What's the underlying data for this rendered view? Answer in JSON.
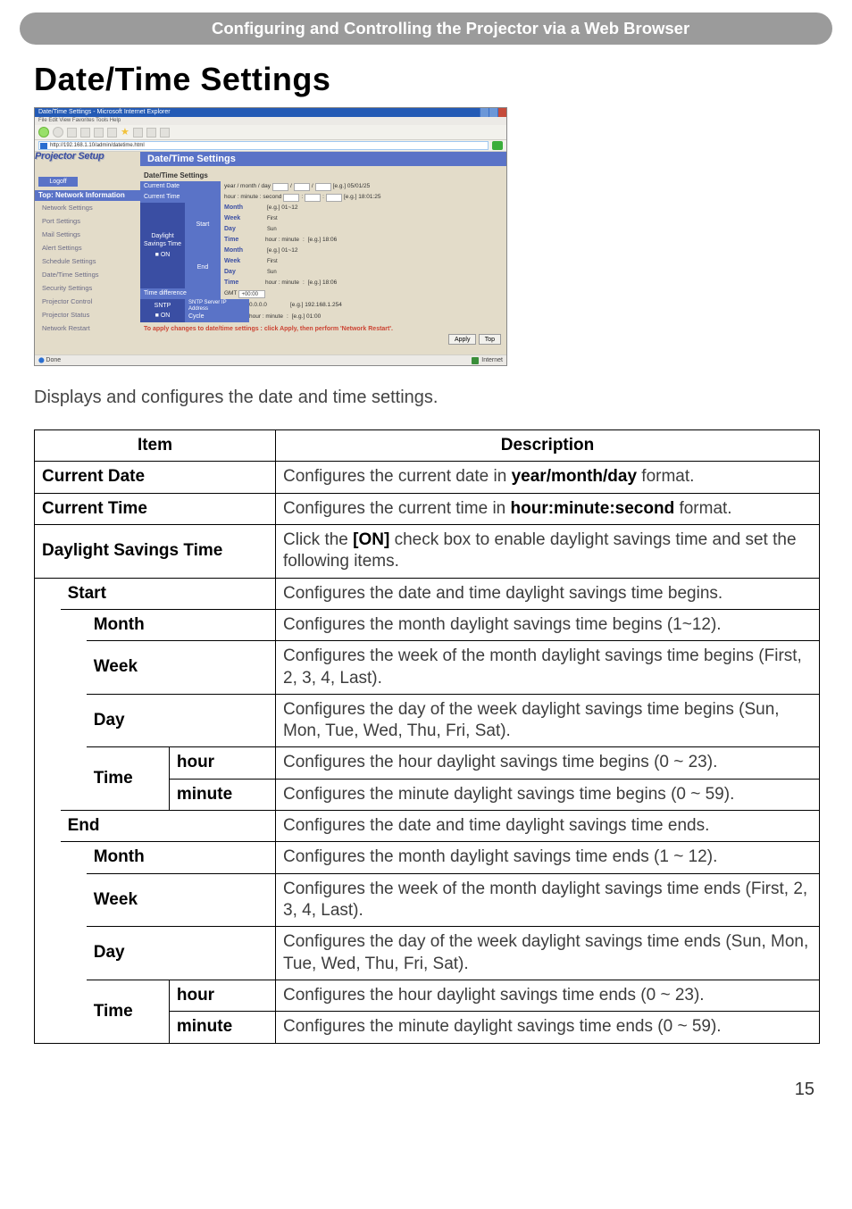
{
  "header_band": "Configuring and Controlling the Projector via a Web Browser",
  "page_title": "Date/Time Settings",
  "intro": "Displays and configures the date and time settings.",
  "page_number": "15",
  "table": {
    "head_item": "Item",
    "head_desc": "Description",
    "current_date": {
      "label": "Current Date",
      "desc_pre": "Configures the current date in ",
      "bold": "year/month/day",
      "desc_post": " format."
    },
    "current_time": {
      "label": "Current Time",
      "desc_pre": "Configures the current time in ",
      "bold": "hour:minute:second",
      "desc_post": " format."
    },
    "dst": {
      "label": "Daylight Savings Time",
      "desc_pre": "Click the ",
      "bold": "[ON]",
      "desc_post": " check box to enable daylight savings time and set the following items."
    },
    "start": {
      "label": "Start",
      "desc": "Configures the date and time daylight savings time begins."
    },
    "start_month": {
      "label": "Month",
      "desc": "Configures the month daylight savings time begins (1~12)."
    },
    "start_week": {
      "label": "Week",
      "desc": "Configures the week of the month daylight savings time begins (First, 2, 3, 4, Last)."
    },
    "start_day": {
      "label": "Day",
      "desc": "Configures the day of the week daylight savings time begins (Sun, Mon, Tue, Wed, Thu, Fri, Sat)."
    },
    "start_time": {
      "label": "Time"
    },
    "start_hour": {
      "label": "hour",
      "desc": "Configures the hour daylight savings time begins (0 ~ 23)."
    },
    "start_minute": {
      "label": "minute",
      "desc": "Configures the minute daylight savings time begins (0 ~ 59)."
    },
    "end": {
      "label": "End",
      "desc": "Configures the date and time daylight savings time ends."
    },
    "end_month": {
      "label": "Month",
      "desc": "Configures the month daylight savings time ends (1 ~ 12)."
    },
    "end_week": {
      "label": "Week",
      "desc": "Configures the week of the month daylight savings time ends (First, 2, 3, 4, Last)."
    },
    "end_day": {
      "label": "Day",
      "desc": "Configures the day of the week daylight savings time ends (Sun, Mon, Tue, Wed, Thu, Fri, Sat)."
    },
    "end_time": {
      "label": "Time"
    },
    "end_hour": {
      "label": "hour",
      "desc": "Configures the hour daylight savings time ends (0 ~ 23)."
    },
    "end_minute": {
      "label": "minute",
      "desc": "Configures the minute daylight savings time ends  (0 ~ 59)."
    }
  },
  "screenshot": {
    "window_title": "Date/Time Settings - Microsoft Internet Explorer",
    "menubar": "File   Edit   View   Favorites   Tools   Help",
    "address": "http://192.168.1.10/admin/datetime.html",
    "go_label": "Go",
    "setup_label": "Projector Setup",
    "main_title": "Date/Time Settings",
    "section_label": "Date/Time Settings",
    "logoff": "Logoff",
    "sidebar_header": "Top: Network Information",
    "sidebar_items": [
      "Network Settings",
      "Port Settings",
      "Mail Settings",
      "Alert Settings",
      "Schedule Settings",
      "Date/Time Settings",
      "Security Settings",
      "Projector Control",
      "Projector Status",
      "Network Restart"
    ],
    "rows": {
      "current_date": {
        "label": "Current Date",
        "val_label": "year / month / day",
        "eg": "[e.g.] 05/01/25"
      },
      "current_time": {
        "label": "Current Time",
        "val_label": "hour : minute : second",
        "eg": "[e.g.] 18:01:25"
      },
      "dst_group": {
        "vlabel": "Daylight Savings Time",
        "on": "ON",
        "start": {
          "label": "Start",
          "month": {
            "lab": "Month",
            "eg": "[e.g.] 01~12"
          },
          "week": {
            "lab": "Week",
            "opt": "First"
          },
          "day": {
            "lab": "Day",
            "opt": "Sun"
          },
          "time": {
            "lab": "Time",
            "val": "hour : minute",
            "eg": "[e.g.] 18:06"
          }
        },
        "end": {
          "label": "End",
          "month": {
            "lab": "Month",
            "eg": "[e.g.] 01~12"
          },
          "week": {
            "lab": "Week",
            "opt": "First"
          },
          "day": {
            "lab": "Day",
            "opt": "Sun"
          },
          "time": {
            "lab": "Time",
            "val": "hour : minute",
            "eg": "[e.g.] 18:06"
          }
        }
      },
      "timediff": {
        "label": "Time difference",
        "val_label": "GMT",
        "opt": "+00:00"
      },
      "sntp": {
        "vlabel": "SNTP",
        "on": "ON",
        "server": {
          "label": "SNTP Server IP Address",
          "val": "0.0.0.0",
          "eg": "[e.g.] 192.168.1.254"
        },
        "cycle": {
          "label": "Cycle",
          "val": "hour : minute",
          "eg": "[e.g.] 01:00"
        }
      }
    },
    "note": "To apply changes to date/time settings : click Apply, then perform 'Network Restart'.",
    "buttons": {
      "apply": "Apply",
      "top": "Top"
    },
    "status_done": "Done",
    "status_internet": "Internet"
  }
}
